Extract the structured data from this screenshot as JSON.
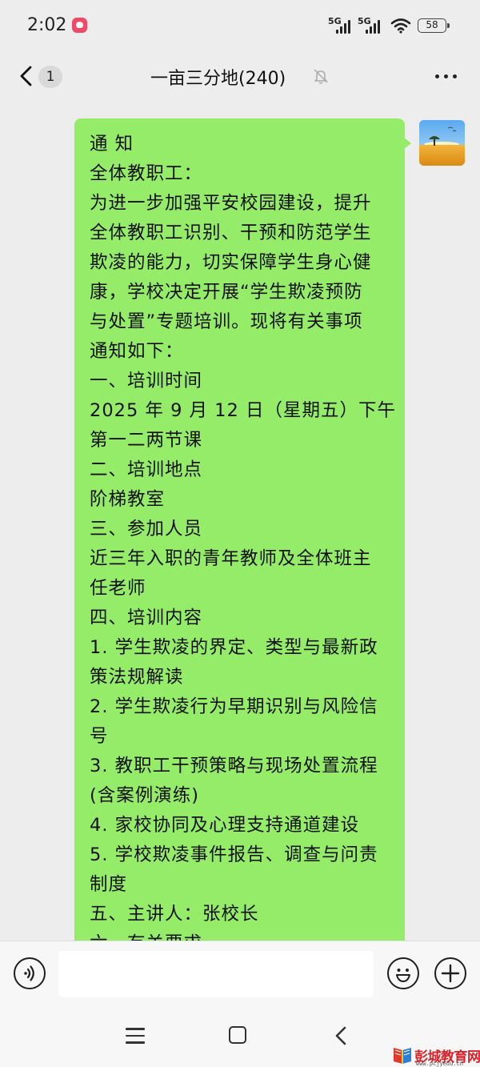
{
  "status_bar": {
    "time": "2:02",
    "network_1": "5G",
    "network_2": "5G",
    "battery": "58"
  },
  "nav": {
    "unread_count": "1",
    "title": "一亩三分地(240)"
  },
  "message": {
    "lines": [
      "通  知",
      "全体教职工：",
      "为进一步加强平安校园建设，提升",
      "全体教职工识别、干预和防范学生",
      "欺凌的能力，切实保障学生身心健",
      "康，学校决定开展“学生欺凌预防",
      "与处置”专题培训。现将有关事项",
      "通知如下：",
      "一、培训时间",
      "2025 年 9 月 12 日（星期五）下午",
      "第一二两节课",
      "二、培训地点",
      "阶梯教室",
      "三、参加人员",
      "近三年入职的青年教师及全体班主",
      "任老师",
      "四、培训内容",
      "1. 学生欺凌的界定、类型与最新政",
      "策法规解读",
      "2. 学生欺凌行为早期识别与风险信",
      "号",
      "3. 教职工干预策略与现场处置流程",
      "(含案例演练)",
      "4. 家校协同及心理支持通道建设",
      "5. 学校欺凌事件报告、调查与问责",
      "制度",
      "五、主讲人：张校长",
      "六、有关要求"
    ]
  },
  "input": {
    "value": "",
    "placeholder": ""
  },
  "watermark": {
    "text": "彭城教育网",
    "url": "www.pcjyedu.cn"
  },
  "colors": {
    "bubble": "#95ec69",
    "background": "#ededed",
    "watermark": "#d8232a"
  }
}
